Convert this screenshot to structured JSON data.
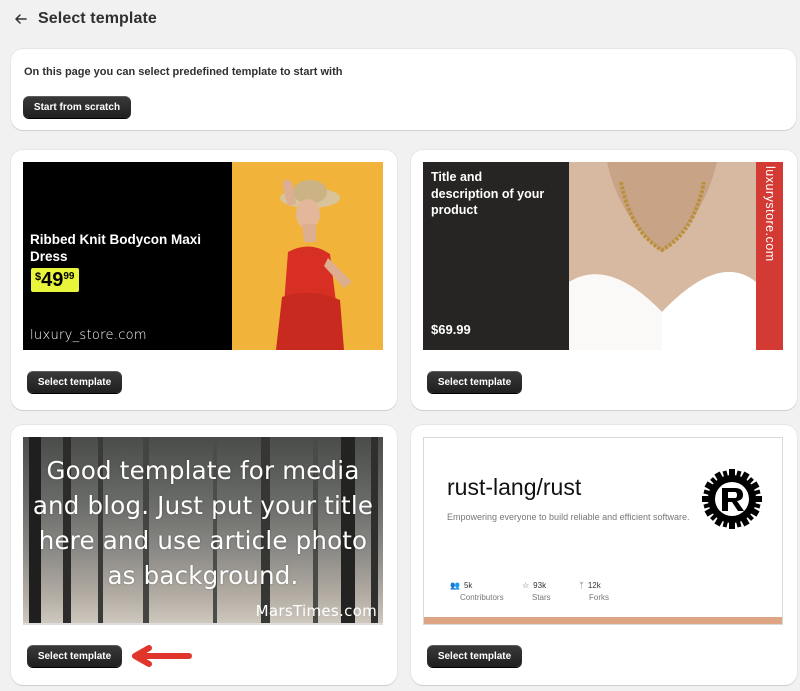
{
  "header": {
    "title": "Select template",
    "back_icon": "arrow-left-icon"
  },
  "intro": {
    "text": "On this page you can select predefined template to start with",
    "button": "Start from scratch"
  },
  "templates": [
    {
      "select_label": "Select template",
      "title": "Ribbed Knit Bodycon Maxi Dress",
      "price_symbol": "$",
      "price_main": "49",
      "price_cents": "99",
      "domain": "luxury_store.com"
    },
    {
      "select_label": "Select template",
      "title": "Title and description of your product",
      "price": "$69.99",
      "vertical_text": "luxurystore.com"
    },
    {
      "select_label": "Select template",
      "text": "Good template for media and blog. Just put your title here and use article photo as background.",
      "domain": "MarsTimes.com"
    },
    {
      "select_label": "Select template",
      "title": "rust-lang/rust",
      "description": "Empowering everyone to build reliable and efficient software.",
      "stats": [
        {
          "icon": "people-icon",
          "value": "5k",
          "label": "Contributors"
        },
        {
          "icon": "star-icon",
          "value": "93k",
          "label": "Stars"
        },
        {
          "icon": "fork-icon",
          "value": "12k",
          "label": "Forks"
        }
      ],
      "logo": "rust-gear-logo",
      "bar_color": "#dea584"
    }
  ],
  "annotation": {
    "icon": "red-arrow-left-icon",
    "color": "#e0352b"
  }
}
